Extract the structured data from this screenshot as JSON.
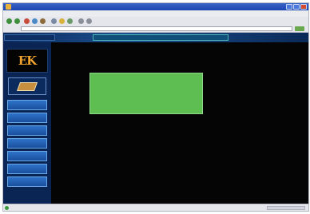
{
  "window": {
    "title": ""
  },
  "menu": [
    {
      "label": ""
    },
    {
      "label": ""
    },
    {
      "label": ""
    },
    {
      "label": ""
    },
    {
      "label": ""
    },
    {
      "label": ""
    }
  ],
  "address": {
    "label": "",
    "value": ""
  },
  "banner": {
    "title": ""
  },
  "logo": {
    "text": "EK"
  },
  "sidebar": {
    "items": [
      {
        "label": ""
      },
      {
        "label": ""
      },
      {
        "label": ""
      },
      {
        "label": ""
      },
      {
        "label": ""
      },
      {
        "label": ""
      },
      {
        "label": ""
      }
    ]
  },
  "content": {
    "heading": "",
    "authors": "",
    "cd_text": "",
    "paragraphs": [
      "",
      "",
      "",
      ""
    ]
  },
  "status": {
    "text": ""
  },
  "colors": {
    "accent": "#5fbe52",
    "sidebar": "#0a2554",
    "authors": "#d9a83a"
  }
}
